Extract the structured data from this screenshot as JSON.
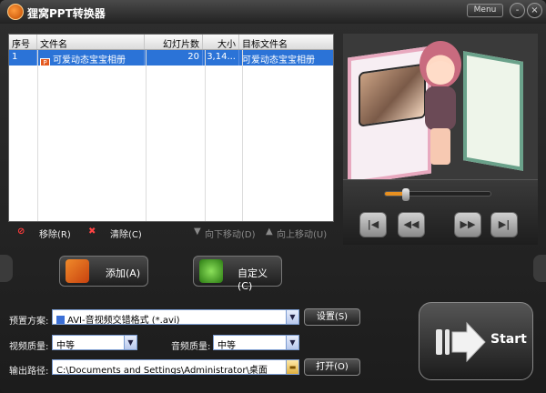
{
  "app": {
    "title": "狸窝PPT转换器",
    "menu_label": "Menu",
    "min_symbol": "-",
    "close_symbol": "×"
  },
  "table": {
    "headers": [
      "序号",
      "文件名",
      "幻灯片数",
      "大小",
      "目标文件名"
    ],
    "rows": [
      {
        "index": "1",
        "filename": "可爱动态宝宝相册",
        "slides": "20",
        "size": "3,14...",
        "target": "可爱动态宝宝相册"
      }
    ]
  },
  "list_tools": {
    "remove": "移除(R)",
    "clear": "清除(C)",
    "move_down": "向下移动(D)",
    "move_up": "向上移动(U)"
  },
  "player": {
    "progress": 0.18,
    "buttons": [
      "|◀",
      "◀◀",
      "▶▶",
      "▶|"
    ]
  },
  "actions": {
    "add": "添加(A)",
    "customize": "自定义(C)"
  },
  "settings": {
    "preset_label": "预置方案:",
    "preset_value": "AVI-音视频交错格式 (*.avi)",
    "setup_button": "设置(S)",
    "video_quality_label": "视频质量:",
    "video_quality_value": "中等",
    "audio_quality_label": "音频质量:",
    "audio_quality_value": "中等",
    "output_label": "输出路径:",
    "output_path": "C:\\Documents and Settings\\Administrator\\桌面",
    "open_button": "打开(O)"
  },
  "start": {
    "label": "Start"
  },
  "colors": {
    "selection": "#2b73d7",
    "accent": "#e89020"
  },
  "icons": [
    "app-logo-icon",
    "ppt-file-icon",
    "remove-icon",
    "clear-icon",
    "move-down-icon",
    "move-up-icon",
    "add-icon",
    "customize-icon",
    "dropdown-icon",
    "folder-icon",
    "start-arrow-icon"
  ]
}
